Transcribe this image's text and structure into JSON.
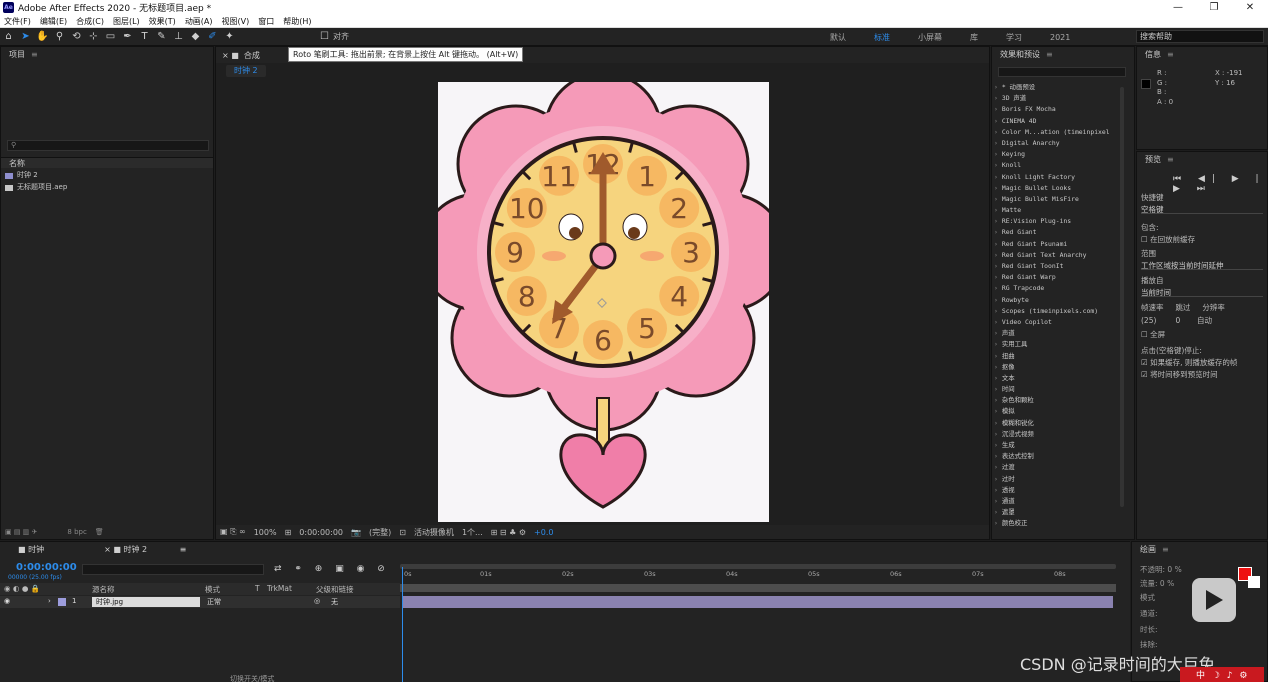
{
  "window": {
    "title": "Adobe After Effects 2020 - 无标题项目.aep *",
    "logo": "Ae",
    "minimize": "—",
    "maximize": "❐",
    "close": "✕"
  },
  "menu": [
    "文件(F)",
    "编辑(E)",
    "合成(C)",
    "图层(L)",
    "效果(T)",
    "动画(A)",
    "视图(V)",
    "窗口",
    "帮助(H)"
  ],
  "toolbar": {
    "snap_label": "对齐",
    "workspaces": [
      "默认",
      "标准",
      "小屏幕",
      "库",
      "学习",
      "2021"
    ],
    "selected_workspace": "标准",
    "help_placeholder": "搜索帮助",
    "tooltip": "Roto 笔刷工具: 拖出前景; 在背景上按住 Alt 键拖动。 (Alt+W)"
  },
  "project": {
    "title": "项目",
    "column_name": "名称",
    "items": [
      {
        "name": "时钟 2",
        "color": "#8f8fcf"
      },
      {
        "name": "无标题项目.aep",
        "color": "#c8c8c8"
      }
    ],
    "footer_bpc": "8 bpc"
  },
  "composition": {
    "tab_label": "合成",
    "subtab": "时钟 2",
    "footer": {
      "zoom": "100%",
      "timecode": "0:00:00:00",
      "resolution": "(完整)",
      "camera": "活动摄像机",
      "views": "1个...",
      "exposure": "+0.0"
    },
    "clock_numbers": [
      "12",
      "1",
      "2",
      "3",
      "4",
      "5",
      "6",
      "7",
      "8",
      "9",
      "10",
      "11"
    ]
  },
  "effects": {
    "title": "效果和预设",
    "items": [
      "* 动画预设",
      "3D 声道",
      "Boris FX Mocha",
      "CINEMA 4D",
      "Color M...ation (timeinpixel",
      "Digital Anarchy",
      "Keying",
      "Knoll",
      "Knoll Light Factory",
      "Magic Bullet Looks",
      "Magic Bullet MisFire",
      "Matte",
      "RE:Vision Plug-ins",
      "Red Giant",
      "Red Giant Psunami",
      "Red Giant Text Anarchy",
      "Red Giant ToonIt",
      "Red Giant Warp",
      "RG Trapcode",
      "Rowbyte",
      "Scopes (timeinpixels.com)",
      "Video Copilot",
      "声道",
      "实用工具",
      "扭曲",
      "抠像",
      "文本",
      "时间",
      "杂色和颗粒",
      "模拟",
      "模糊和锐化",
      "沉浸式视频",
      "生成",
      "表达式控制",
      "过渡",
      "过时",
      "透视",
      "通道",
      "遮罩",
      "颜色校正"
    ]
  },
  "info": {
    "title": "信息",
    "r": "R :",
    "g": "G :",
    "b": "B :",
    "a": "A : 0",
    "x": "X : -191",
    "y": "Y : 16"
  },
  "preview": {
    "title": "预览",
    "controls": "⏮ ◀| ▶ |▶ ⏭",
    "shortcut_label": "快捷键",
    "shortcut_value": "空格键",
    "include_label": "包含:",
    "cache_label": "在回放前缓存",
    "range_label": "范围",
    "range_value": "工作区域按当前时间延伸",
    "play_from_label": "播放自",
    "play_from_value": "当前时间",
    "frame_rate_label": "帧速率",
    "skip_label": "跳过",
    "resolution_label": "分辨率",
    "frame_rate_value": "(25)",
    "skip_value": "0",
    "resolution_value": "自动",
    "fullscreen_label": "全屏",
    "stop_label": "点击(空格键)停止:",
    "stop_opt1": "如果缓存, 则播放缓存的帧",
    "stop_opt2": "将时间移到预览时间"
  },
  "timeline": {
    "tabs": [
      "时钟",
      "时钟 2"
    ],
    "timecode": "0:00:00:00",
    "timecode_sub": "00000 (25.00 fps)",
    "columns": {
      "source": "源名称",
      "mode": "模式",
      "t": "T",
      "trkmat": "TrkMat",
      "parent": "父级和链接"
    },
    "layer": {
      "index": "1",
      "name": "时钟.jpg",
      "mode": "正常",
      "parent": "无"
    },
    "ruler_ticks": [
      "0s",
      "01s",
      "02s",
      "03s",
      "04s",
      "05s",
      "06s",
      "07s",
      "08s"
    ],
    "footer_toggle": "切换开关/模式"
  },
  "paint": {
    "title": "绘画",
    "labels": [
      "不透明:",
      "流量:",
      "模式",
      "通道:",
      "时长:",
      "抹除:"
    ],
    "opacity": "0 %",
    "flow": "0 %",
    "foreground": "#ee1111",
    "background": "#ffffff"
  },
  "watermark": "CSDN @记录时间的大巨兔",
  "tray": "中 ☽ ♪ ⚙"
}
